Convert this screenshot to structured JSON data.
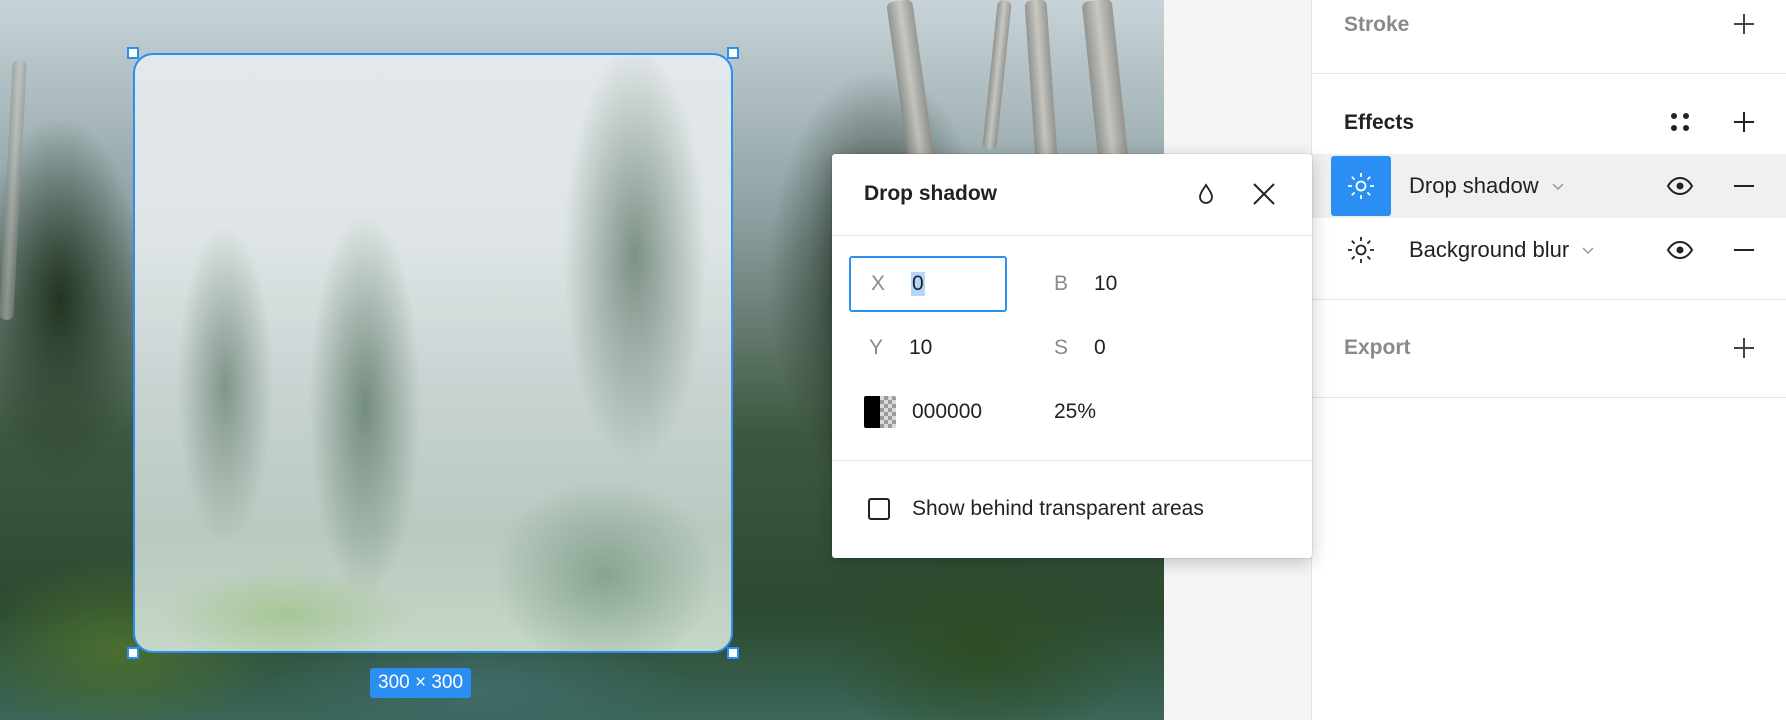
{
  "canvas": {
    "frame_size_label": "300 × 300"
  },
  "popover": {
    "title": "Drop shadow",
    "fields": {
      "x": {
        "label": "X",
        "value": "0"
      },
      "y": {
        "label": "Y",
        "value": "10"
      },
      "b": {
        "label": "B",
        "value": "10"
      },
      "s": {
        "label": "S",
        "value": "0"
      }
    },
    "color": {
      "hex": "000000",
      "opacity": "25%"
    },
    "checkbox": {
      "label": "Show behind transparent areas",
      "checked": false
    },
    "icons": {
      "style": "drop-icon",
      "close": "close-icon"
    }
  },
  "panel": {
    "stroke": {
      "title": "Stroke"
    },
    "effects": {
      "title": "Effects",
      "items": [
        {
          "label": "Drop shadow",
          "selected": true
        },
        {
          "label": "Background blur",
          "selected": false
        }
      ]
    },
    "export": {
      "title": "Export"
    }
  },
  "colors": {
    "accent": "#2b8ef2",
    "text": "#222222",
    "muted": "#8a8a8a"
  }
}
